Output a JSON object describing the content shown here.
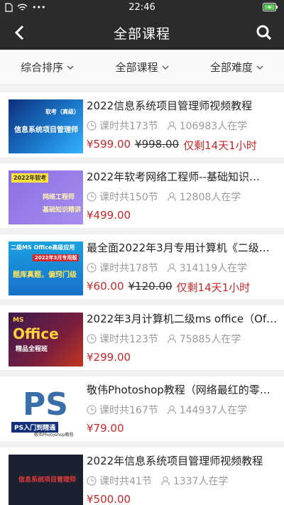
{
  "status_bar": {
    "time": "22:46",
    "carrier_icons": [
      "sim-icon",
      "wifi-icon",
      "more-dots-icon"
    ],
    "battery_icon": "battery-charging-icon"
  },
  "navbar": {
    "title": "全部课程",
    "back_icon": "back-icon",
    "search_icon": "search-icon"
  },
  "filters": [
    {
      "label": "综合排序"
    },
    {
      "label": "全部课程"
    },
    {
      "label": "全部难度"
    }
  ],
  "courses": [
    {
      "title": "2022信息系统项目管理师视频教程",
      "lessons": "课时共173节",
      "learners": "106983人在学",
      "price": "¥599.00",
      "original_price": "¥998.00",
      "deadline": "仅剩14天1小时",
      "thumb": {
        "caption_top": "软考（高级）",
        "caption_main": "信息系统项目管理师"
      }
    },
    {
      "title": "2022年软考网络工程师--基础知识…",
      "lessons": "课时共150节",
      "learners": "12808人在学",
      "price": "¥499.00",
      "original_price": "",
      "deadline": "",
      "thumb": {
        "caption_top": "2022年软考",
        "caption_main": "网络工程师",
        "caption_sub": "基础知识精讲"
      }
    },
    {
      "title": "最全面2022年3月专用计算机《二级…",
      "lessons": "课时共178节",
      "learners": "314119人在学",
      "price": "¥60.00",
      "original_price": "¥120.00",
      "deadline": "仅剩14天1小时",
      "thumb": {
        "caption_top": "二级MS Office高级应用",
        "caption_badge": "2022年3月专用版",
        "caption_main": "题库真题，偏窍门级"
      }
    },
    {
      "title": "2022年3月计算机二级ms office（Of…",
      "lessons": "课时共123节",
      "learners": "75885人在学",
      "price": "¥299.00",
      "original_price": "",
      "deadline": "",
      "thumb": {
        "caption_top": "MS",
        "caption_main": "Office",
        "caption_sub": "精品全程班"
      }
    },
    {
      "title": "敬伟Photoshop教程（网络最红的零…",
      "lessons": "课时共167节",
      "learners": "144937人在学",
      "price": "¥79.00",
      "original_price": "",
      "deadline": "",
      "thumb": {
        "caption_main": "PS入门到精通",
        "caption_sub": "敬伟Photoshop教程"
      }
    },
    {
      "title": "2022年信息系统项目管理师视频教程",
      "lessons": "课时共41节",
      "learners": "1337人在学",
      "price": "¥500.00",
      "original_price": "",
      "deadline": "",
      "thumb": {
        "caption_main": "信息系统项目管理师"
      }
    }
  ]
}
